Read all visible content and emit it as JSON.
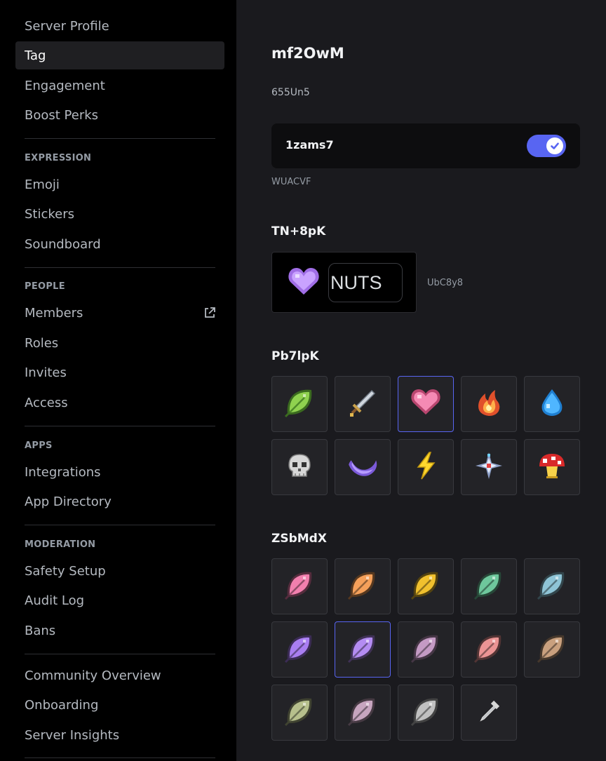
{
  "sidebar": {
    "top_items": [
      {
        "label": "Server Profile"
      },
      {
        "label": "Tag",
        "selected": true
      },
      {
        "label": "Engagement"
      },
      {
        "label": "Boost Perks"
      }
    ],
    "sections": [
      {
        "header": "EXPRESSION",
        "items": [
          {
            "label": "Emoji"
          },
          {
            "label": "Stickers"
          },
          {
            "label": "Soundboard"
          }
        ]
      },
      {
        "header": "PEOPLE",
        "items": [
          {
            "label": "Members",
            "icon": "external-link-icon"
          },
          {
            "label": "Roles"
          },
          {
            "label": "Invites"
          },
          {
            "label": "Access"
          }
        ]
      },
      {
        "header": "APPS",
        "items": [
          {
            "label": "Integrations"
          },
          {
            "label": "App Directory"
          }
        ]
      },
      {
        "header": "MODERATION",
        "items": [
          {
            "label": "Safety Setup"
          },
          {
            "label": "Audit Log"
          },
          {
            "label": "Bans"
          }
        ]
      },
      {
        "header": "",
        "items": [
          {
            "label": "Community Overview"
          },
          {
            "label": "Onboarding"
          },
          {
            "label": "Server Insights"
          }
        ]
      }
    ]
  },
  "main": {
    "title": "mf2OwM",
    "description": "655Un5",
    "toggle": {
      "label": "1zams7",
      "enabled": true,
      "note": "WUACVF"
    },
    "preview": {
      "heading": "TN+8pK",
      "badge": "heart-badge-icon",
      "tag_text": "NUTS",
      "note": "UbC8y8"
    },
    "badges": {
      "heading": "Pb7lpK",
      "items": [
        {
          "icon": "leaf-icon"
        },
        {
          "icon": "sword-icon"
        },
        {
          "icon": "heart-icon",
          "selected": true
        },
        {
          "icon": "fire-icon"
        },
        {
          "icon": "water-drop-icon"
        },
        {
          "icon": "skull-icon"
        },
        {
          "icon": "crescent-moon-icon"
        },
        {
          "icon": "lightning-icon"
        },
        {
          "icon": "sparkle-icon"
        },
        {
          "icon": "mushroom-icon"
        }
      ]
    },
    "colors": {
      "heading": "ZSbMdX",
      "items": [
        {
          "icon": "leaf-pink-icon",
          "color": "#f27fae"
        },
        {
          "icon": "leaf-orange-icon",
          "color": "#f5a05a"
        },
        {
          "icon": "leaf-yellow-icon",
          "color": "#f0c02e"
        },
        {
          "icon": "leaf-green-icon",
          "color": "#6ec79c"
        },
        {
          "icon": "leaf-blue-icon",
          "color": "#8ec4d6"
        },
        {
          "icon": "leaf-violet-icon",
          "color": "#a97ef2"
        },
        {
          "icon": "leaf-lavender-icon",
          "color": "#b48cf2",
          "selected": true
        },
        {
          "icon": "leaf-mauve-icon",
          "color": "#c49ac4"
        },
        {
          "icon": "leaf-salmon-icon",
          "color": "#eb9494"
        },
        {
          "icon": "leaf-tan-icon",
          "color": "#c9a07e"
        },
        {
          "icon": "leaf-olive-icon",
          "color": "#b6bf8c"
        },
        {
          "icon": "leaf-rose-icon",
          "color": "#c7a5bf"
        },
        {
          "icon": "leaf-gray-icon",
          "color": "#c0c0c0"
        },
        {
          "icon": "eyedropper-icon"
        }
      ]
    }
  }
}
